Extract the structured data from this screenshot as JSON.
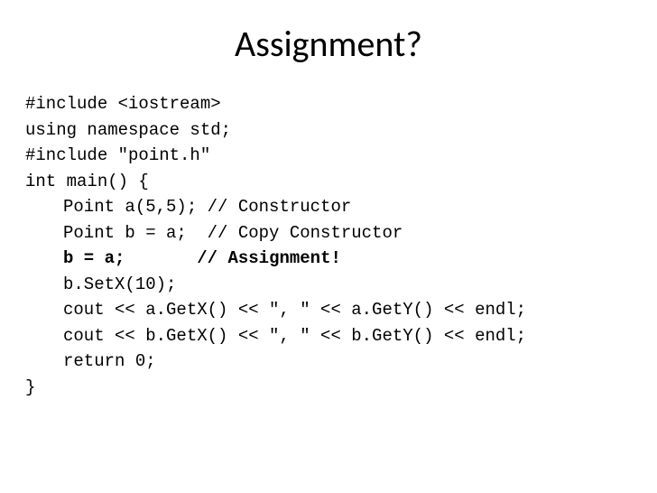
{
  "title": "Assignment?",
  "code": {
    "line1": "#include <iostream>",
    "line2": "using namespace std;",
    "line3": "",
    "line4": "#include \"point.h\"",
    "line5": "",
    "line6": "int main() {",
    "line7": "Point a(5,5); // Constructor",
    "line8": "Point b = a;  // Copy Constructor",
    "line9_code": "b = a;",
    "line9_spacer": "       ",
    "line9_comment": "// Assignment!",
    "line10": "b.SetX(10);",
    "line11": "cout << a.GetX() << \", \" << a.GetY() << endl;",
    "line12": "cout << b.GetX() << \", \" << b.GetY() << endl;",
    "line13": "return 0;",
    "line14": "}"
  }
}
